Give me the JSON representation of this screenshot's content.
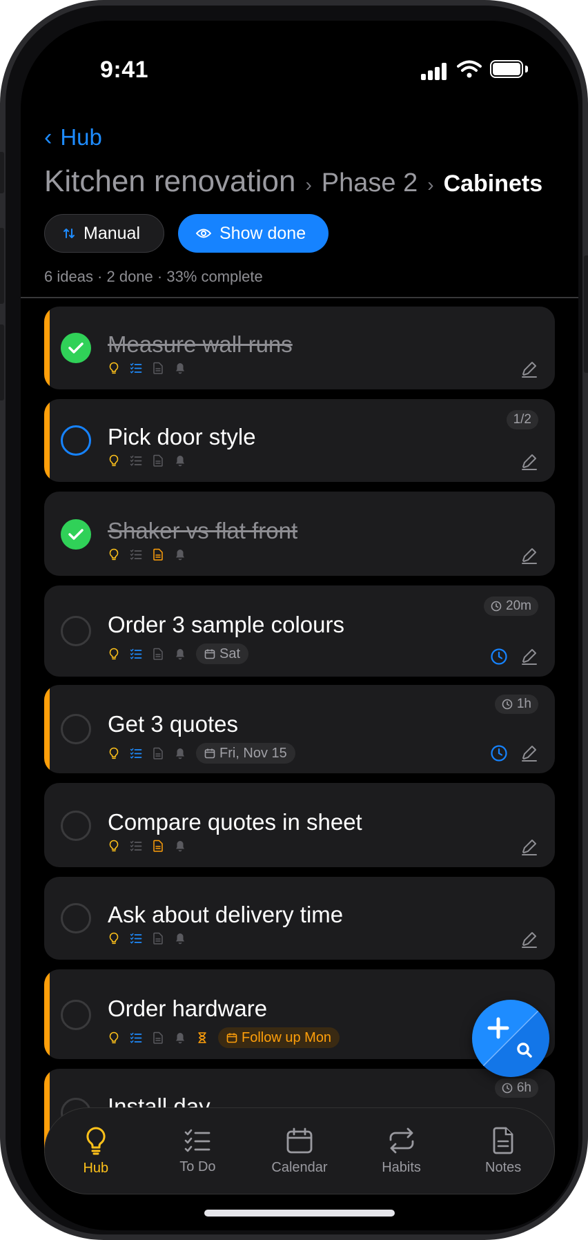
{
  "status_bar": {
    "time": "9:41"
  },
  "nav": {
    "back_label": "Hub"
  },
  "breadcrumb": {
    "items": [
      "Kitchen renovation",
      "Phase 2",
      "Cabinets"
    ]
  },
  "toolbar": {
    "sort_label": "Manual",
    "show_done_label": "Show done"
  },
  "summary": "6 ideas · 2 done · 33% complete",
  "items": [
    {
      "title": "Measure wall runs",
      "done": true,
      "flagged": true
    },
    {
      "title": "Pick door style",
      "done": false,
      "flagged": true,
      "progress": "1/2"
    },
    {
      "title": "Shaker vs flat front",
      "done": true,
      "flagged": false
    },
    {
      "title": "Order 3 sample colours",
      "done": false,
      "flagged": false,
      "duration": "20m",
      "date": "Sat"
    },
    {
      "title": "Get 3 quotes",
      "done": false,
      "flagged": true,
      "duration": "1h",
      "date": "Fri, Nov 15"
    },
    {
      "title": "Compare quotes in sheet",
      "done": false,
      "flagged": false
    },
    {
      "title": "Ask about delivery time",
      "done": false,
      "flagged": false
    },
    {
      "title": "Order hardware",
      "done": false,
      "flagged": true,
      "follow_up": "Follow up Mon"
    },
    {
      "title": "Install day",
      "done": false,
      "flagged": true,
      "duration": "6h"
    }
  ],
  "tabs": [
    {
      "label": "Hub",
      "icon": "bulb-icon",
      "active": true
    },
    {
      "label": "To Do",
      "icon": "checklist-icon"
    },
    {
      "label": "Calendar",
      "icon": "calendar-icon"
    },
    {
      "label": "Habits",
      "icon": "repeat-icon"
    },
    {
      "label": "Notes",
      "icon": "note-icon"
    }
  ],
  "colors": {
    "accent": "#1683ff",
    "flag": "#ff9f0a",
    "done": "#30d158",
    "hub": "#ffc21a"
  }
}
